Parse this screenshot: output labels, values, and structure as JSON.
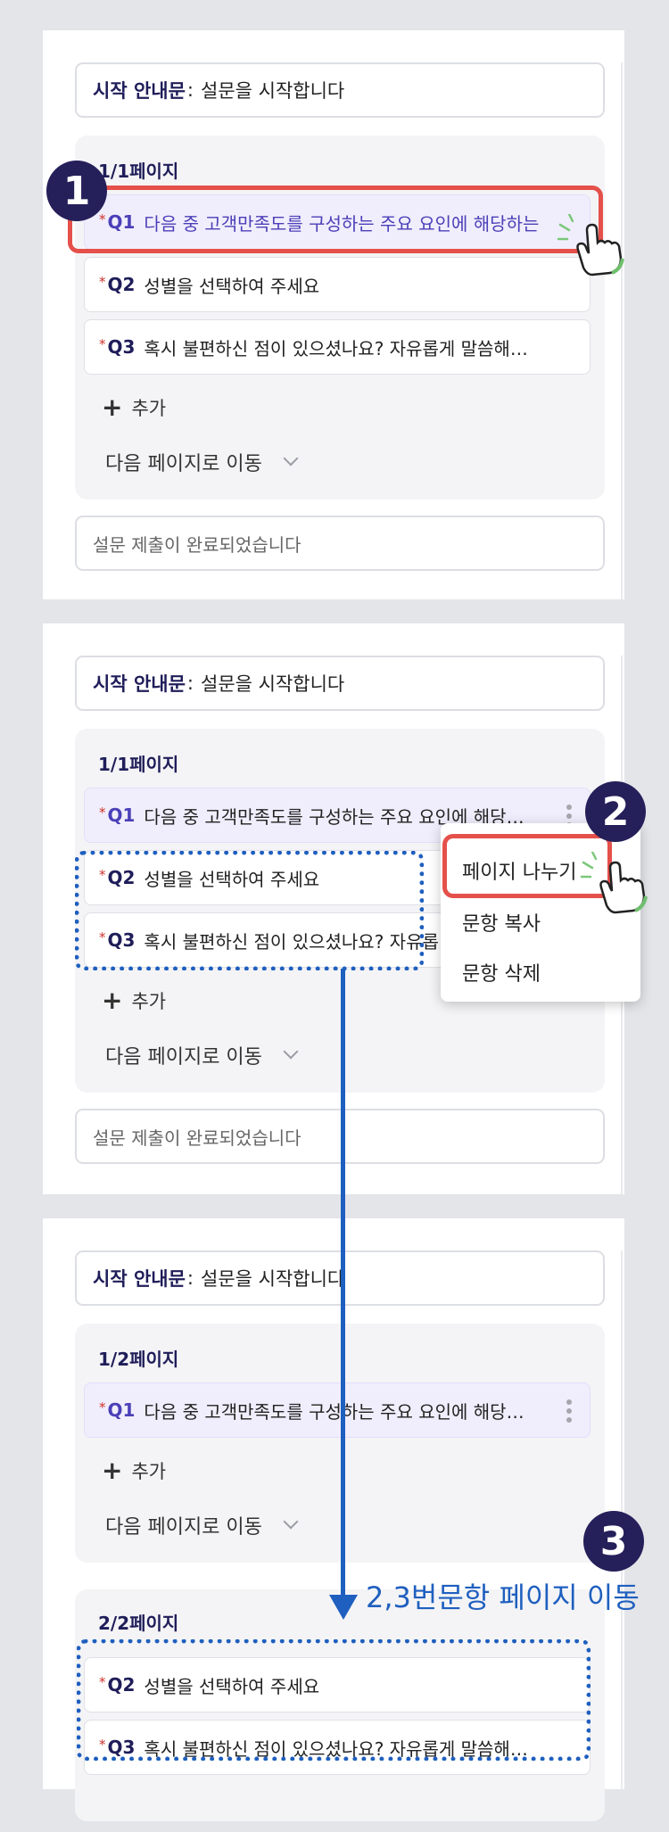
{
  "intro_label": "시작 안내문",
  "intro_separator": ":",
  "intro_text": "설문을 시작합니다",
  "completion_text": "설문 제출이 완료되었습니다",
  "add_label": "추가",
  "move_label": "다음 페이지로 이동",
  "q_star": "*",
  "questions": [
    {
      "num": "Q1",
      "text_full": "다음 중 고객만족도를 구성하는 주요 요인에 해당하는",
      "text_short": "다음 중 고객만족도를 구성하는 주요 요인에 해당…"
    },
    {
      "num": "Q2",
      "text": "성별을 선택하여 주세요"
    },
    {
      "num": "Q3",
      "text": "혹시 불편하신 점이 있으셨나요? 자유롭게 말씀해…",
      "text_clipped": "혹시 불편하신 점이 있으셨나요? 자유롭"
    }
  ],
  "step1": {
    "badge": "1",
    "page_title": "1/1페이지"
  },
  "step2": {
    "badge": "2",
    "page_title": "1/1페이지",
    "menu": [
      "페이지 나누기",
      "문항 복사",
      "문항 삭제"
    ]
  },
  "step3": {
    "badge": "3",
    "page1_title": "1/2페이지",
    "page2_title": "2/2페이지",
    "note": "2,3번문항 페이지 이동"
  },
  "colors": {
    "accent": "#1f5fbf",
    "highlight": "#e5504a",
    "badge": "#251f5a",
    "heading": "#1f1d59"
  }
}
